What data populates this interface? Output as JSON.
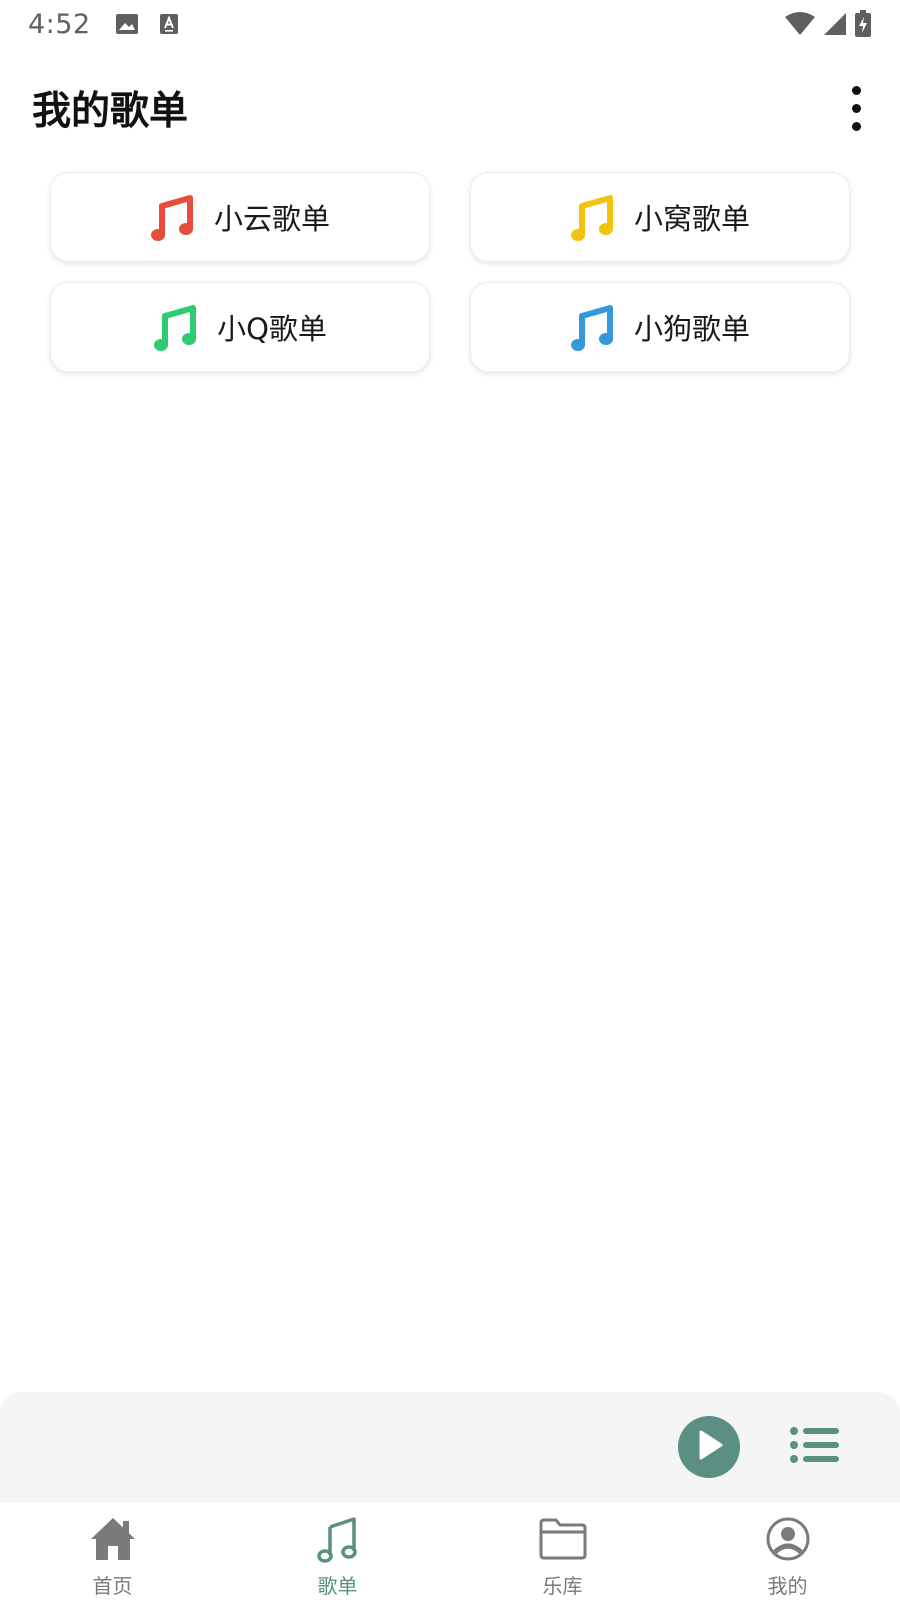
{
  "status_bar": {
    "time": "4:52",
    "left_icons": [
      "image-icon",
      "keyboard-a-icon"
    ],
    "right_icons": [
      "wifi-icon",
      "signal-icon",
      "battery-charging-icon"
    ]
  },
  "header": {
    "title": "我的歌单",
    "menu_icon": "more-vert-icon"
  },
  "playlists": [
    {
      "name": "小云歌单",
      "icon": "music-note-icon",
      "color": "#e74c3c"
    },
    {
      "name": "小窝歌单",
      "icon": "music-note-icon",
      "color": "#f1c40f"
    },
    {
      "name": "小Q歌单",
      "icon": "music-note-icon",
      "color": "#2ecc71"
    },
    {
      "name": "小狗歌单",
      "icon": "music-note-icon",
      "color": "#3498db"
    }
  ],
  "player": {
    "play_icon": "play-icon",
    "queue_icon": "playlist-icon",
    "accent": "#5b8f84"
  },
  "nav": {
    "items": [
      {
        "label": "首页",
        "icon": "home-icon",
        "active": false
      },
      {
        "label": "歌单",
        "icon": "music-note-icon",
        "active": true
      },
      {
        "label": "乐库",
        "icon": "folder-icon",
        "active": false
      },
      {
        "label": "我的",
        "icon": "account-icon",
        "active": false
      }
    ],
    "active_color": "#5b8f84",
    "inactive_color": "#7a7a7a"
  }
}
